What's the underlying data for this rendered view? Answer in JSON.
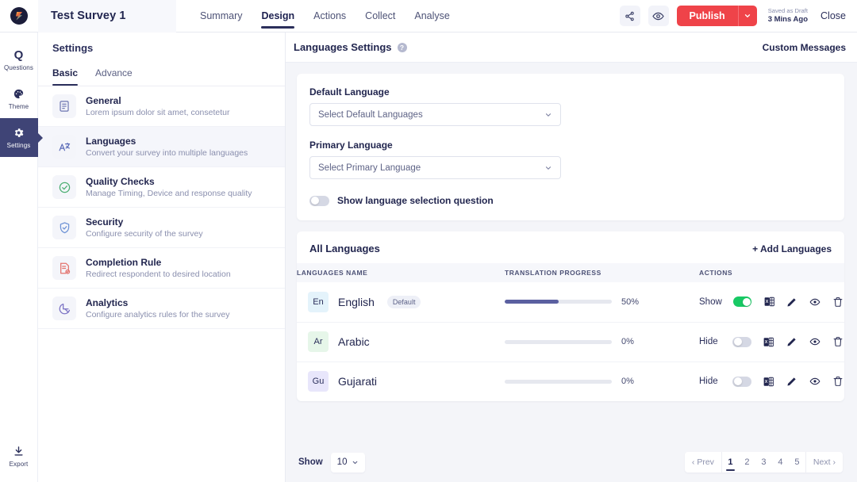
{
  "topbar": {
    "logo_icon": "app-logo-icon",
    "survey_title": "Test Survey 1",
    "tabs": [
      {
        "label": "Summary",
        "active": false
      },
      {
        "label": "Design",
        "active": true
      },
      {
        "label": "Actions",
        "active": false
      },
      {
        "label": "Collect",
        "active": false
      },
      {
        "label": "Analyse",
        "active": false
      }
    ],
    "share_icon": "share-icon",
    "preview_icon": "eye-icon",
    "publish_label": "Publish",
    "publish_caret_icon": "chevron-down-icon",
    "saved_line1": "Saved as Draft",
    "saved_line2": "3 Mins Ago",
    "close_label": "Close",
    "publish_color": "#ef4349"
  },
  "rail": {
    "items": [
      {
        "label": "Questions",
        "icon": "question-letter-icon",
        "active": false
      },
      {
        "label": "Theme",
        "icon": "palette-icon",
        "active": false
      },
      {
        "label": "Settings",
        "icon": "gear-icon",
        "active": true
      }
    ],
    "export": {
      "label": "Export",
      "icon": "download-icon"
    },
    "active_color": "#3f4476"
  },
  "settings_panel": {
    "heading": "Settings",
    "subtabs": [
      {
        "label": "Basic",
        "active": true
      },
      {
        "label": "Advance",
        "active": false
      }
    ],
    "items": [
      {
        "title": "General",
        "desc": "Lorem ipsum dolor sit amet, consetetur",
        "icon": "document-icon",
        "active": false
      },
      {
        "title": "Languages",
        "desc": "Convert your survey into multiple languages",
        "icon": "translate-icon",
        "active": true
      },
      {
        "title": "Quality Checks",
        "desc": "Manage Timing, Device and response quality",
        "icon": "check-circle-icon",
        "active": false
      },
      {
        "title": "Security",
        "desc": "Configure security of the survey",
        "icon": "shield-check-icon",
        "active": false
      },
      {
        "title": "Completion Rule",
        "desc": "Redirect respondent to desired location",
        "icon": "document-check-icon",
        "active": false
      },
      {
        "title": "Analytics",
        "desc": "Configure analytics rules for the survey",
        "icon": "pie-chart-icon",
        "active": false
      }
    ]
  },
  "main": {
    "title": "Languages Settings",
    "help_icon": "help-circle-icon",
    "help_glyph": "?",
    "custom_messages_label": "Custom Messages",
    "default_language": {
      "label": "Default Language",
      "value": "",
      "placeholder": "Select Default Languages",
      "caret_icon": "chevron-down-icon"
    },
    "primary_language": {
      "label": "Primary Language",
      "value": "",
      "placeholder": "Select Primary Language",
      "caret_icon": "chevron-down-icon"
    },
    "show_language_question": {
      "label": "Show language selection question",
      "on": false
    },
    "all_languages": {
      "heading": "All Languages",
      "add_label": "+ Add Languages",
      "columns": [
        "Languages Name",
        "Translation Progress",
        "Actions"
      ],
      "rows": [
        {
          "code": "En",
          "code_bg": "#e4f3fb",
          "name": "English",
          "pill": "Default",
          "progress": 50,
          "progress_label": "50%",
          "visibility": "Show",
          "toggle_on": true,
          "actions": [
            "excel-export-icon",
            "edit-pencil-icon",
            "eye-icon",
            "trash-icon"
          ]
        },
        {
          "code": "Ar",
          "code_bg": "#e6f6e9",
          "name": "Arabic",
          "pill": "",
          "progress": 0,
          "progress_label": "0%",
          "visibility": "Hide",
          "toggle_on": false,
          "actions": [
            "excel-export-icon",
            "edit-pencil-icon",
            "eye-icon",
            "trash-icon"
          ]
        },
        {
          "code": "Gu",
          "code_bg": "#e8e6fb",
          "name": "Gujarati",
          "pill": "",
          "progress": 0,
          "progress_label": "0%",
          "visibility": "Hide",
          "toggle_on": false,
          "actions": [
            "excel-export-icon",
            "edit-pencil-icon",
            "eye-icon",
            "trash-icon"
          ]
        }
      ]
    },
    "footer": {
      "show_label": "Show",
      "page_size": "10",
      "page_size_caret": "chevron-down-icon",
      "prev_label": "Prev",
      "next_label": "Next",
      "pages": [
        "1",
        "2",
        "3",
        "4",
        "5"
      ],
      "current_page": "1"
    }
  }
}
